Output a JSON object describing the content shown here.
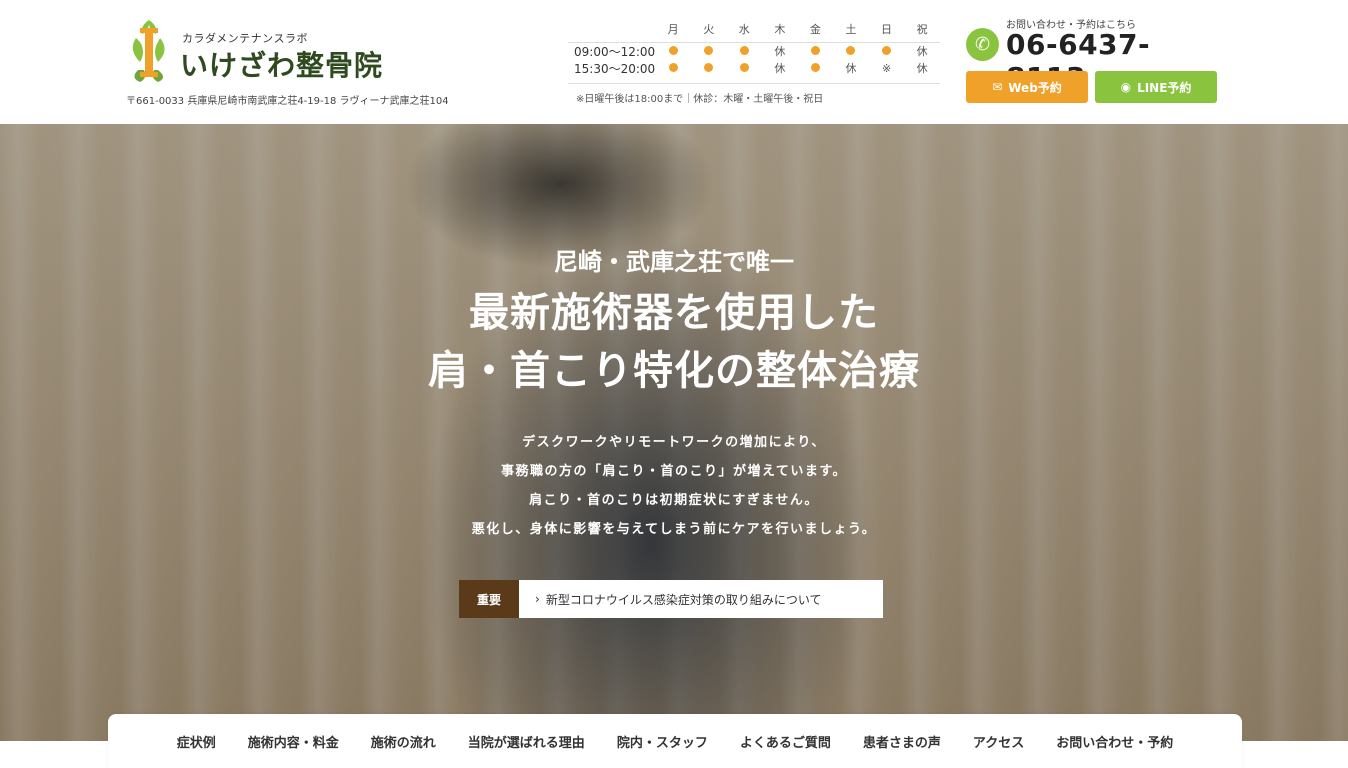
{
  "header": {
    "logo_sub": "カラダメンテナンスラボ",
    "logo_main": "いけざわ整骨院",
    "address": "〒661-0033 兵庫県尼崎市南武庫之荘4-19-18 ラヴィーナ武庫之荘104",
    "hours": {
      "days": [
        "月",
        "火",
        "水",
        "木",
        "金",
        "土",
        "日",
        "祝"
      ],
      "rows": [
        {
          "time": "09:00〜12:00",
          "cells": [
            "●",
            "●",
            "●",
            "休",
            "●",
            "●",
            "●",
            "休"
          ]
        },
        {
          "time": "15:30〜20:00",
          "cells": [
            "●",
            "●",
            "●",
            "休",
            "●",
            "休",
            "※",
            "休"
          ]
        }
      ],
      "note": "※日曜午後は18:00まで｜休診：木曜・土曜午後・祝日"
    },
    "contact": {
      "label": "お問い合わせ・予約はこちら",
      "phone": "06-6437-8113",
      "web_button": "Web予約",
      "line_button": "LINE予約"
    }
  },
  "hero": {
    "lead": "尼崎・武庫之荘で唯一",
    "title_line1": "最新施術器を使用した",
    "title_line2": "肩・首こり特化の整体治療",
    "body": [
      "デスクワークやリモートワークの増加により、",
      "事務職の方の「肩こり・首のこり」が増えています。",
      "肩こり・首のこりは初期症状にすぎません。",
      "悪化し、身体に影響を与えてしまう前にケアを行いましょう。"
    ],
    "notice_tag": "重要",
    "notice_text": "新型コロナウイルス感染症対策の取り組みについて"
  },
  "nav": {
    "items": [
      "症状例",
      "施術内容・料金",
      "施術の流れ",
      "当院が選ばれる理由",
      "院内・スタッフ",
      "よくあるご質問",
      "患者さまの声",
      "アクセス",
      "お問い合わせ・予約"
    ]
  },
  "colors": {
    "accent_orange": "#f0a12a",
    "accent_green": "#8ac43f",
    "notice_brown": "#5b3a1a"
  }
}
